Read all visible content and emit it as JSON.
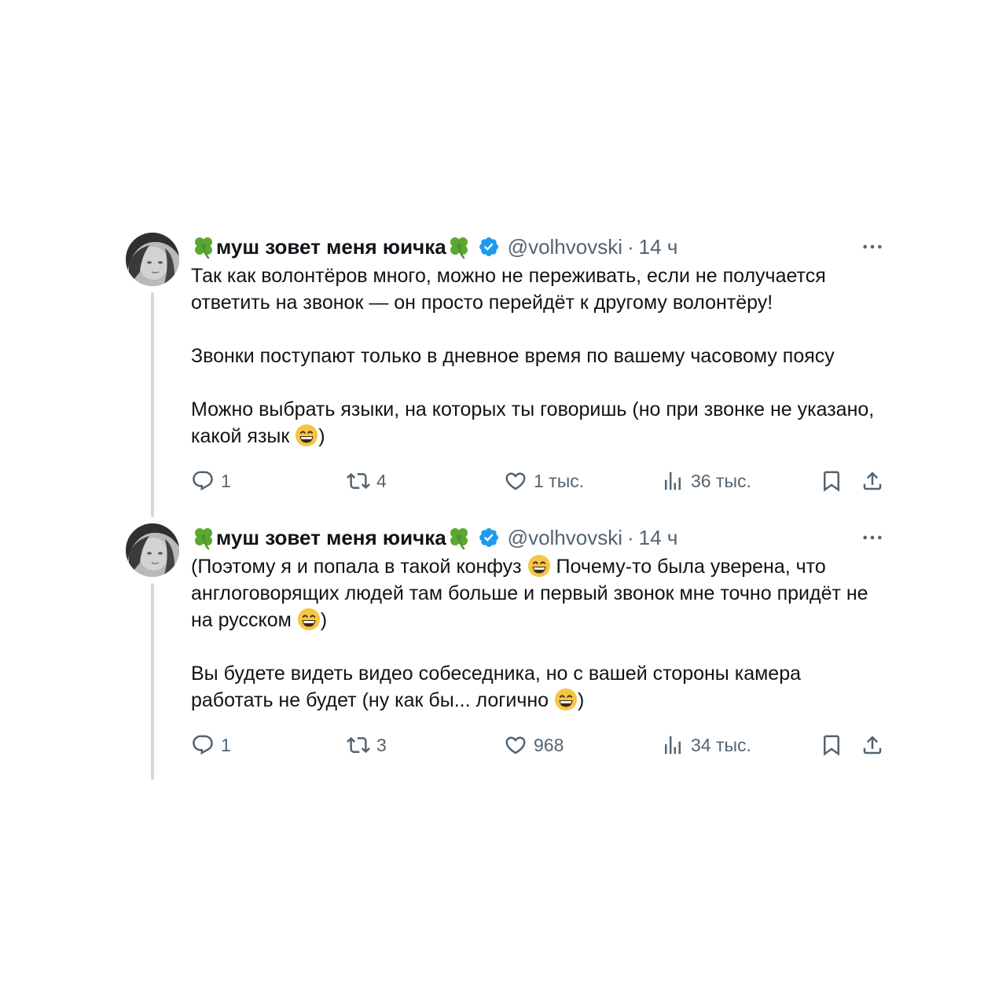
{
  "tweets": [
    {
      "display_name": "муш зовет меня юичка",
      "handle": "@volhvovski",
      "separator": "·",
      "time": "14 ч",
      "paragraphs": [
        [
          "Так как волонтёров много, можно не переживать, если не получается ответить на звонок — он просто перейдёт к другому волонтёру!"
        ],
        [
          "Звонки поступают только в дневное время по вашему часовому поясу"
        ],
        [
          "Можно выбрать языки, на которых ты говоришь (но при звонке не указано, какой язык ",
          ")"
        ]
      ],
      "replies": "1",
      "reposts": "4",
      "likes": "1 тыс.",
      "views": "36 тыс."
    },
    {
      "display_name": "муш зовет меня юичка",
      "handle": "@volhvovski",
      "separator": "·",
      "time": "14 ч",
      "paragraphs": [
        [
          "(Поэтому я и попала в такой конфуз ",
          " Почему-то была уверена, что англоговорящих людей там больше и первый звонок мне точно придёт не на русском ",
          ")"
        ],
        [
          "Вы будете видеть видео собеседника, но с вашей стороны камера работать не будет (ну как бы... логично ",
          ")"
        ]
      ],
      "replies": "1",
      "reposts": "3",
      "likes": "968",
      "views": "34 тыс."
    }
  ],
  "colors": {
    "text": "#0f1419",
    "secondary": "#536471",
    "verified": "#1d9bf0",
    "thread_line": "#cfd9de",
    "clover": "#5aa832",
    "emoji": "#f6c544"
  },
  "icons": {
    "clover": "four-leaf-clover-icon",
    "verified": "verified-badge-icon",
    "more": "more-dots-icon",
    "reply": "reply-icon",
    "repost": "repost-icon",
    "like": "heart-icon",
    "views": "views-chart-icon",
    "bookmark": "bookmark-icon",
    "share": "share-icon",
    "emoji": "grinning-face-emoji"
  }
}
